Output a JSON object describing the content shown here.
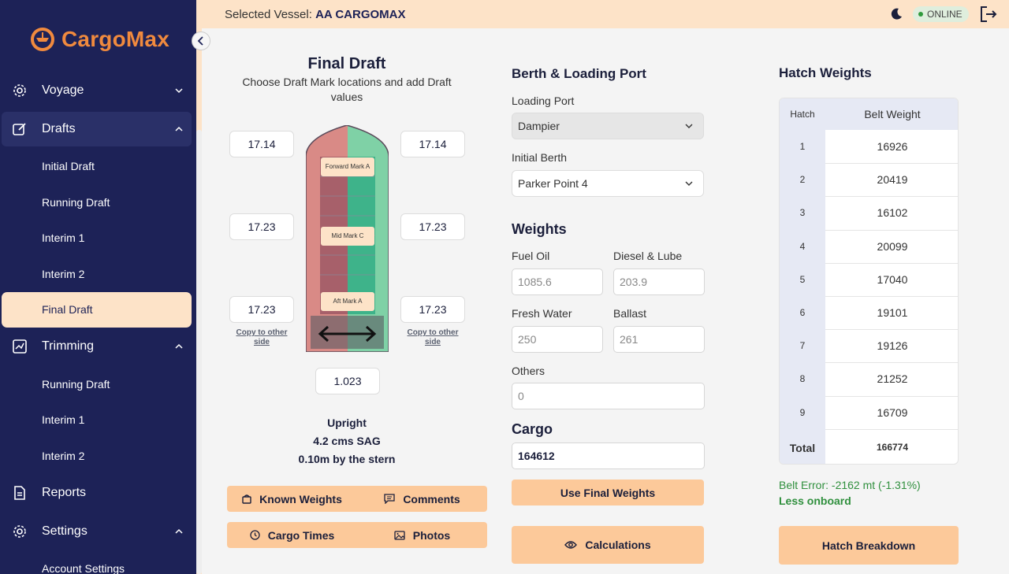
{
  "app": {
    "name": "CargoMax"
  },
  "header": {
    "vessel_label": "Selected Vessel:",
    "vessel_name": "AA CARGOMAX",
    "status": "ONLINE"
  },
  "sidebar": {
    "voyage": "Voyage",
    "drafts": "Drafts",
    "drafts_items": [
      "Initial Draft",
      "Running Draft",
      "Interim 1",
      "Interim 2",
      "Final Draft"
    ],
    "trimming": "Trimming",
    "trimming_items": [
      "Running Draft",
      "Interim 1",
      "Interim 2"
    ],
    "reports": "Reports",
    "settings": "Settings",
    "settings_items": [
      "Account Settings"
    ]
  },
  "final_draft": {
    "title": "Final Draft",
    "subtitle": "Choose Draft Mark locations and add Draft values",
    "fwd_left": "17.14",
    "fwd_right": "17.14",
    "mid_left": "17.23",
    "mid_right": "17.23",
    "aft_left": "17.23",
    "aft_right": "17.23",
    "density": "1.023",
    "copy_left": "Copy to other side",
    "copy_right": "Copy to other side",
    "marks": [
      "Forward Mark A",
      "Mid Mark C",
      "Aft Mark A"
    ],
    "summary": [
      "Upright",
      "4.2 cms SAG",
      "0.10m by the stern"
    ],
    "buttons": {
      "known_weights": "Known Weights",
      "comments": "Comments",
      "cargo_times": "Cargo Times",
      "photos": "Photos"
    }
  },
  "berth": {
    "title": "Berth & Loading Port",
    "loading_port_label": "Loading Port",
    "loading_port": "Dampier",
    "initial_berth_label": "Initial Berth",
    "initial_berth": "Parker Point 4"
  },
  "weights": {
    "title": "Weights",
    "fuel_oil_label": "Fuel Oil",
    "fuel_oil": "1085.6",
    "diesel_label": "Diesel & Lube",
    "diesel": "203.9",
    "fresh_water_label": "Fresh Water",
    "fresh_water": "250",
    "ballast_label": "Ballast",
    "ballast": "261",
    "others_label": "Others",
    "others": "0"
  },
  "cargo": {
    "title": "Cargo",
    "value": "164612",
    "use_final": "Use Final Weights",
    "calculations": "Calculations"
  },
  "hatch": {
    "title": "Hatch Weights",
    "col_hatch": "Hatch",
    "col_weight": "Belt Weight",
    "rows": [
      {
        "hatch": "1",
        "weight": "16926"
      },
      {
        "hatch": "2",
        "weight": "20419"
      },
      {
        "hatch": "3",
        "weight": "16102"
      },
      {
        "hatch": "4",
        "weight": "20099"
      },
      {
        "hatch": "5",
        "weight": "17040"
      },
      {
        "hatch": "6",
        "weight": "19101"
      },
      {
        "hatch": "7",
        "weight": "19126"
      },
      {
        "hatch": "8",
        "weight": "21252"
      },
      {
        "hatch": "9",
        "weight": "16709"
      }
    ],
    "total_label": "Total",
    "total": "166774",
    "belt_error": "Belt Error: -2162 mt (-1.31%)",
    "less_onboard": "Less onboard",
    "breakdown": "Hatch Breakdown"
  },
  "colors": {
    "navy": "#1d2257",
    "orange": "#f08a3e",
    "peach": "#fde3c8",
    "button": "#fcc99a",
    "green": "#2f8f3d"
  }
}
